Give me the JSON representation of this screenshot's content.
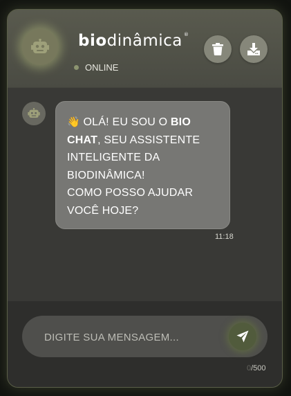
{
  "header": {
    "logo": {
      "bold_part": "bio",
      "rest": "dinâmica",
      "mark": "®"
    },
    "status": "ONLINE",
    "buttons": {
      "trash_icon": "trash-icon",
      "download_icon": "download-icon"
    }
  },
  "messages": [
    {
      "sender": "bot",
      "avatar_icon": "robot-icon",
      "lines": {
        "emoji": "👋",
        "l1": " OLÁ! EU SOU O ",
        "l1_bold": "BIO",
        "l2_bold": "CHAT",
        "l2": ", SEU ASSISTENTE",
        "l3": "INTELIGENTE DA",
        "l4": "BIODINÂMICA!",
        "l5": "COMO POSSO AJUDAR",
        "l6": "VOCÊ HOJE?"
      },
      "time": "11:18"
    }
  ],
  "composer": {
    "placeholder": "DIGITE SUA MENSAGEM...",
    "value": "",
    "send_icon": "send-icon",
    "char_count": "0",
    "char_max": "/500"
  },
  "colors": {
    "accent": "#515b3c",
    "bubble": "#777774",
    "header": "#595a4e",
    "status_dot": "#8c9470"
  }
}
